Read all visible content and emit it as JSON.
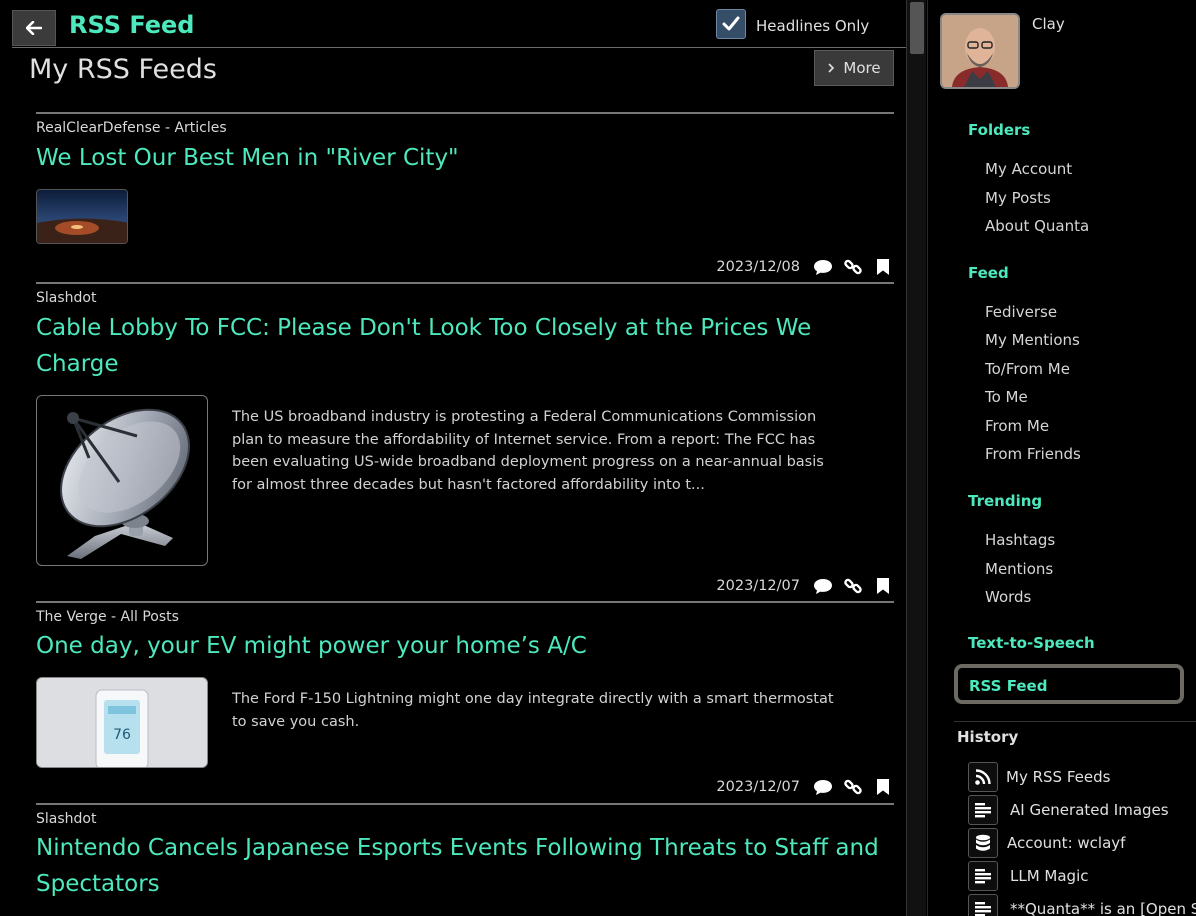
{
  "header": {
    "title": "RSS Feed",
    "headlines_only_label": "Headlines Only",
    "headlines_only_checked": true
  },
  "list": {
    "title": "My RSS Feeds",
    "more_label": "More"
  },
  "articles": [
    {
      "source": "RealClearDefense - Articles",
      "headline": "We Lost Our Best Men in \"River City\"",
      "description": "",
      "date": "2023/12/08"
    },
    {
      "source": "Slashdot",
      "headline": "Cable Lobby To FCC: Please Don't Look Too Closely at the Prices We Charge",
      "description": "The US broadband industry is protesting a Federal Communications Commission plan to measure the affordability of Internet service. From a report: The FCC has been evaluating US-wide broadband deployment progress on a near-annual basis for almost three decades but hasn't factored affordability into t...",
      "date": "2023/12/07"
    },
    {
      "source": "The Verge - All Posts",
      "headline": "One day, your EV might power your home’s A/C",
      "description": "The Ford F-150 Lightning might one day integrate directly with a smart thermostat to save you cash.",
      "date": "2023/12/07",
      "thumb_text": "76"
    },
    {
      "source": "Slashdot",
      "headline": "Nintendo Cancels Japanese Esports Events Following Threats to Staff and Spectators"
    }
  ],
  "user": {
    "name": "Clay"
  },
  "sidebar": {
    "folders": {
      "title": "Folders",
      "items": [
        "My Account",
        "My Posts",
        "About Quanta"
      ]
    },
    "feed": {
      "title": "Feed",
      "items": [
        "Fediverse",
        "My Mentions",
        "To/From Me",
        "To Me",
        "From Me",
        "From Friends"
      ]
    },
    "trending": {
      "title": "Trending",
      "items": [
        "Hashtags",
        "Mentions",
        "Words"
      ]
    },
    "tts": "Text-to-Speech",
    "rss": "RSS Feed"
  },
  "history": {
    "title": "History",
    "items": [
      {
        "label": "My RSS Feeds",
        "icon": "rss-icon"
      },
      {
        "label": "AI Generated Images",
        "icon": "text-lines-icon"
      },
      {
        "label": "Account: wclayf",
        "icon": "database-icon"
      },
      {
        "label": "LLM Magic",
        "icon": "text-lines-icon"
      },
      {
        "label": "**Quanta** is an [Open So",
        "icon": "text-lines-icon"
      }
    ]
  },
  "colors": {
    "accent": "#4de8bd",
    "background": "#000000",
    "button": "#3b3b3b",
    "active_border": "#6d6a64"
  }
}
